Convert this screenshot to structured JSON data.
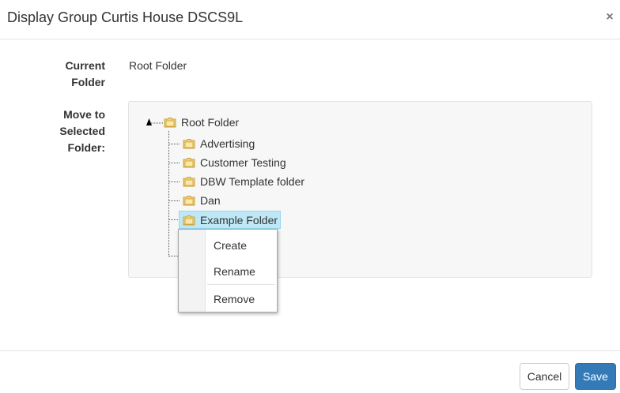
{
  "dialog": {
    "title": "Display Group Curtis House DSCS9L",
    "close_symbol": "×"
  },
  "form": {
    "current_folder_label": "Current Folder",
    "current_folder_value": "Root Folder",
    "move_to_label": "Move to Selected Folder:"
  },
  "tree": {
    "root": "Root Folder",
    "children": [
      {
        "label": "Advertising",
        "icon": "folder-icon"
      },
      {
        "label": "Customer Testing",
        "icon": "folder-icon"
      },
      {
        "label": "DBW Template folder",
        "icon": "folder-icon"
      },
      {
        "label": "Dan",
        "icon": "folder-icon"
      },
      {
        "label": "Example Folder",
        "icon": "folder-icon",
        "selected": true
      }
    ]
  },
  "context_menu": {
    "items": [
      "Create",
      "Rename",
      "Remove"
    ]
  },
  "footer": {
    "cancel_label": "Cancel",
    "save_label": "Save"
  },
  "colors": {
    "primary": "#337ab7",
    "selection": "#bfe8f7",
    "panel_bg": "#f7f7f7"
  }
}
